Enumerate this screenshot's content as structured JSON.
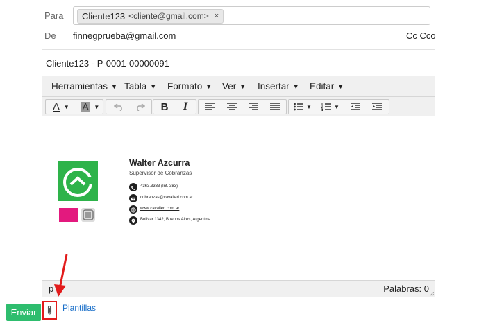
{
  "to": {
    "label": "Para",
    "recipient_name": "Cliente123",
    "recipient_email": "<cliente@gmail.com>",
    "remove_glyph": "×"
  },
  "from": {
    "label": "De",
    "address": "finnegprueba@gmail.com",
    "cc_cco": "Cc Cco"
  },
  "subject": "Cliente123 - P-0001-00000091",
  "editor": {
    "menus": [
      "Herramientas",
      "Tabla",
      "Formato",
      "Ver",
      "Insertar",
      "Editar"
    ],
    "toolbar": {
      "text_color": "A",
      "bg_color": "A",
      "bold": "B",
      "italic": "I"
    },
    "statusbar": {
      "path": "p",
      "word_count": "Palabras: 0"
    }
  },
  "signature": {
    "name": "Walter Azcurra",
    "role": "Supervisor de Cobranzas",
    "phone": "4363.3333 (Int. 383)",
    "email": "cobranzas@cavalieri.com.ar",
    "web": "www.cavalieri.com.ar",
    "address": "Bolívar 1342, Buenos Aires, Argentina",
    "brand_color": "#2eb34a"
  },
  "footer": {
    "send_label": "Enviar",
    "templates_label": "Plantillas"
  },
  "colors": {
    "send_button": "#2ebd6e",
    "link": "#1a6fc9",
    "annotation_red": "#e21b1b"
  }
}
